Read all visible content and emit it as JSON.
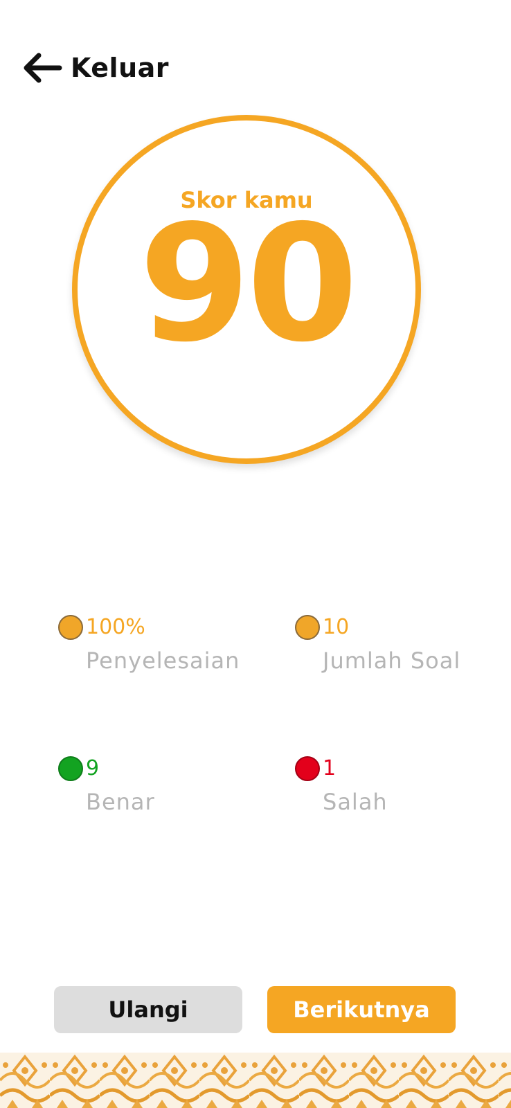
{
  "header": {
    "back_label": "Keluar",
    "back_icon": "arrow-left-icon"
  },
  "score": {
    "label": "Skor kamu",
    "value": "90"
  },
  "stats": [
    {
      "value": "100%",
      "label": "Penyelesaian",
      "color": "#F5A623"
    },
    {
      "value": "10",
      "label": "Jumlah Soal",
      "color": "#F5A623"
    },
    {
      "value": "9",
      "label": "Benar",
      "color": "#13A321"
    },
    {
      "value": "1",
      "label": "Salah",
      "color": "#E3001B"
    }
  ],
  "buttons": {
    "retry_label": "Ulangi",
    "next_label": "Berikutnya"
  },
  "colors": {
    "accent": "#F5A623",
    "correct": "#13A321",
    "wrong": "#E3001B",
    "muted_text": "#B5B5B5",
    "retry_bg": "#DDDDDD"
  }
}
